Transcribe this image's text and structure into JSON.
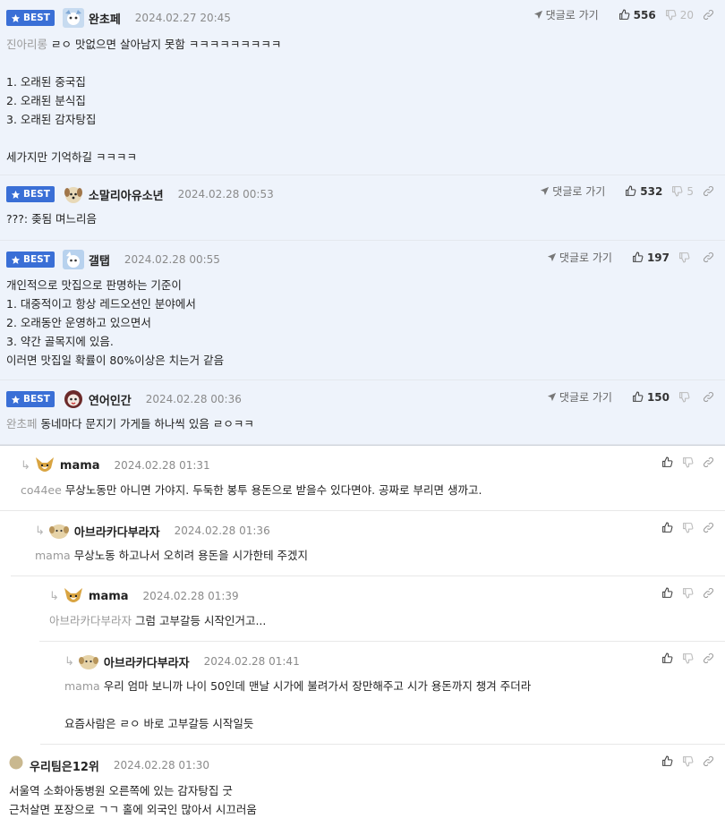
{
  "ui": {
    "best_label": "BEST",
    "goto_label": "댓글로 가기",
    "colors": {
      "best_badge": "#3a6fd6",
      "best_bg": "#eef3fb",
      "muted": "#9a9a9a"
    }
  },
  "comments": [
    {
      "best": true,
      "nick": "완초페",
      "date": "2024.02.27 20:45",
      "mention": "진아리롱",
      "lines": [
        "ㄹㅇ 맛없으면 살아남지 못함 ㅋㅋㅋㅋㅋㅋㅋㅋㅋ",
        "",
        "1. 오래된 중국집",
        "2. 오래된 분식집",
        "3. 오래된 감자탕집",
        "",
        "세가지만 기억하길 ㅋㅋㅋㅋ"
      ],
      "likes": "556",
      "dislikes": "20"
    },
    {
      "best": true,
      "nick": "소말리아유소년",
      "date": "2024.02.28 00:53",
      "mention": "",
      "lines": [
        "???: 좆됨 며느리음"
      ],
      "likes": "532",
      "dislikes": "5"
    },
    {
      "best": true,
      "nick": "갤탭",
      "date": "2024.02.28 00:55",
      "mention": "",
      "lines": [
        "개인적으로 맛집으로 판명하는 기준이",
        "1. 대중적이고 항상 레드오션인 분야에서",
        "2. 오래동안 운영하고 있으면서",
        "3. 약간 골목지에 있음.",
        "이러면 맛집일 확률이 80%이상은 치는거 같음"
      ],
      "likes": "197",
      "dislikes": ""
    },
    {
      "best": true,
      "nick": "연어인간",
      "date": "2024.02.28 00:36",
      "mention": "완초페",
      "lines": [
        "동네마다 문지기 가게들 하나씩 있음 ㄹㅇㅋㅋ"
      ],
      "likes": "150",
      "dislikes": ""
    },
    {
      "depth": 1,
      "nick": "mama",
      "date": "2024.02.28 01:31",
      "mention": "co44ee",
      "lines": [
        "무상노동만 아니면 가야지. 두둑한 봉투 용돈으로 받을수 있다면야. 공짜로 부리면 생까고."
      ]
    },
    {
      "depth": 2,
      "nick": "아브라카다부라자",
      "date": "2024.02.28 01:36",
      "mention": "mama",
      "lines": [
        "무상노동 하고나서 오히려 용돈을 시가한테 주겠지"
      ]
    },
    {
      "depth": 3,
      "nick": "mama",
      "date": "2024.02.28 01:39",
      "mention": "아브라카다부라자",
      "lines": [
        "그럼 고부갈등 시작인거고..."
      ]
    },
    {
      "depth": 4,
      "nick": "아브라카다부라자",
      "date": "2024.02.28 01:41",
      "mention": "mama",
      "lines": [
        "우리 엄마 보니까 나이 50인데 맨날 시가에 불려가서 장만해주고 시가 용돈까지 챙겨 주더라",
        "",
        "요즘사람은 ㄹㅇ 바로 고부갈등 시작일듯"
      ]
    },
    {
      "depth": 0,
      "nick": "우리팀은12위",
      "date": "2024.02.28 01:30",
      "mention": "",
      "lines": [
        "서울역 소화아동병원 오른쪽에 있는 감자탕집 굿",
        "근처살면 포장으로 ㄱㄱ 홀에 외국인 많아서 시끄러움"
      ]
    }
  ]
}
